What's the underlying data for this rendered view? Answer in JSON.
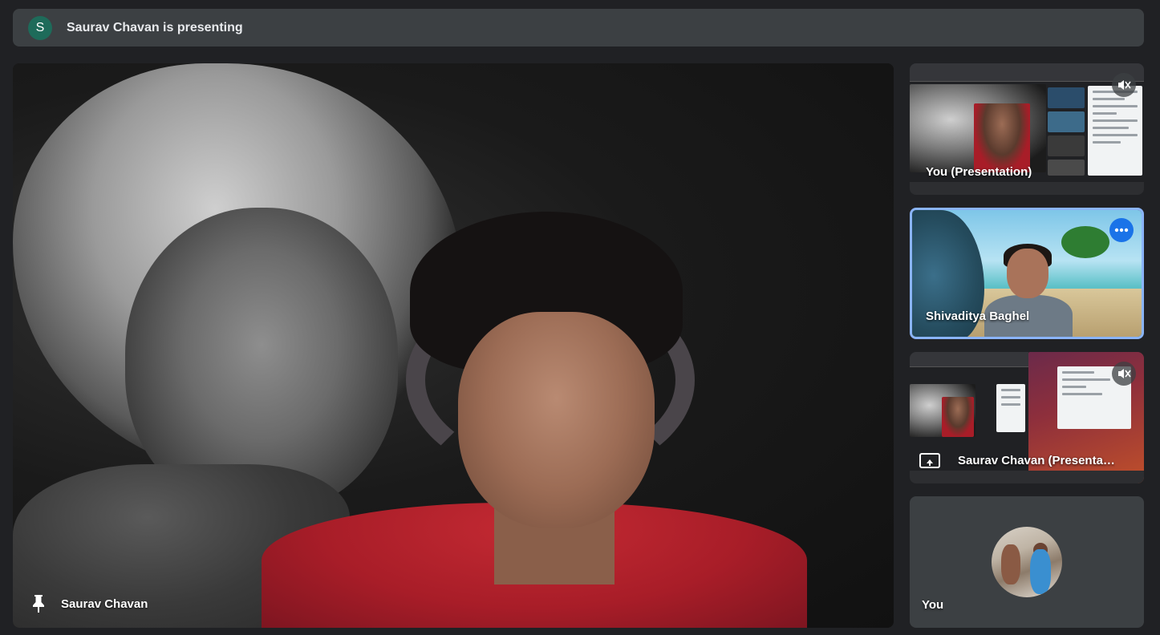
{
  "banner": {
    "avatar_letter": "S",
    "text": "Saurav Chavan is presenting"
  },
  "main_tile": {
    "name": "Saurav Chavan",
    "pin_icon": "pin-icon"
  },
  "sidebar": {
    "tiles": [
      {
        "label": "You (Presentation)",
        "icon": "mic-off-icon"
      },
      {
        "label": "Shivaditya Baghel",
        "icon": "more-options-icon"
      },
      {
        "label": "Saurav Chavan (Presenta…",
        "icon": "mic-off-icon"
      },
      {
        "label": "You",
        "icon": "avatar"
      }
    ]
  },
  "colors": {
    "background": "#202124",
    "tile": "#3c4043",
    "accent": "#1a73e8",
    "active_border": "#8ab4f8"
  }
}
